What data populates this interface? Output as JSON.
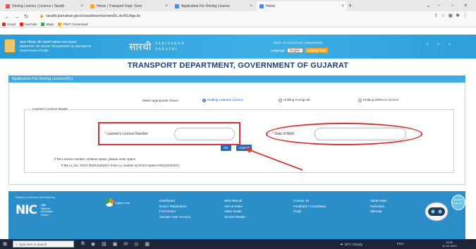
{
  "browser": {
    "tabs": [
      {
        "label": "Driving Licence | Licence | Sarath",
        "color": "#e05555"
      },
      {
        "label": "Home | Transport Dept. Govt.",
        "color": "#f0a830"
      },
      {
        "label": "Application For Driving Licence",
        "color": "#4a8de0"
      },
      {
        "label": "Home",
        "color": "#4a8de0"
      }
    ],
    "new_tab": "+",
    "url": "sarathi.parivahan.gov.in/sarathiservice/newDL.do#DLApp.do",
    "bookmarks": [
      {
        "label": "Gmail",
        "color": "#d93025"
      },
      {
        "label": "YouTube",
        "color": "#e62117"
      },
      {
        "label": "Maps",
        "color": "#34a853"
      },
      {
        "label": "PhET | Download",
        "color": "#f0a830"
      }
    ]
  },
  "site": {
    "ministry_lines": [
      "सड़क परिवहन और राजमार्ग मंत्रालय भारत सरकार",
      "MINISTRY OF ROAD TRANSPORT & HIGHWAYS",
      "Government of India"
    ],
    "logo_hindi": "सारथी",
    "logo_line1": "PARIVAHAN",
    "logo_line2": "SARATHI",
    "dates": "DATE: 10-03-2023   DAY: WEDNESDAY",
    "language_label": "Language",
    "language_value": "English",
    "change_button": "Change Now",
    "font_controls": "A A A",
    "dept_title": "TRANSPORT DEPARTMENT, GOVERNMENT OF GUJARAT",
    "app_bar_title": "Application For Driving Licence(DL)"
  },
  "form": {
    "choice_label": "Select appropriate choice",
    "radios": [
      {
        "label": "Holding Learners Licence",
        "selected": true
      },
      {
        "label": "Holding Foreign DL",
        "selected": false
      },
      {
        "label": "Holding Defence Licence",
        "selected": false
      }
    ],
    "legend": "Learner's Licence Details",
    "ll_label": "Learner's Licence Number",
    "ll_required": "*",
    "ll_value": "",
    "dob_label": "Date of Birth",
    "dob_required": "*",
    "dob_value": "",
    "ok_button": "OK",
    "cancel_button": "Cancel",
    "note_line1": "If the Licence number contains space, please enter space",
    "note_line2": "If the LL No.: RJ14 /0021234/2017 enter LL number as RJ14+Space+0021234/2017"
  },
  "footer": {
    "credit": "Designed, developed and hosted by",
    "nic": "NIC",
    "nic_sub": [
      "राष्ट्रीय",
      "National",
      "Informatics",
      "Centre"
    ],
    "digital_india": "Digital India",
    "col1": [
      "Dashboard",
      "Doctor Registration",
      "Find Doctor",
      "Activate User Account"
    ],
    "col2": [
      "Web Manual",
      "Acts & Rules",
      "Video Guide",
      "Screen Reader"
    ],
    "col3": [
      "Contact Us",
      "Feedback / Complaints",
      "FAQs"
    ],
    "col4": [
      "Vahan Main",
      "Parivahan",
      "Sitemap"
    ],
    "chat_text": "How can I help you?"
  },
  "taskbar": {
    "search_placeholder": "Type here to search",
    "weather": "34°C  Cloudy",
    "time": "15:50",
    "date": "10-03-2023",
    "tray": "ENG"
  }
}
